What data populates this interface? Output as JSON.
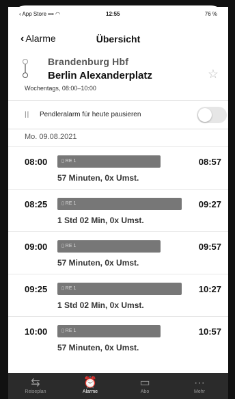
{
  "status_bar": {
    "carrier": "App Store",
    "time": "12:55",
    "battery": "76 %"
  },
  "nav": {
    "back_label": "Alarme",
    "title": "Übersicht"
  },
  "route": {
    "from": "Brandenburg Hbf",
    "to": "Berlin Alexanderplatz",
    "schedule": "Wochentags, 08:00–10:00"
  },
  "pause": {
    "label": "Pendleralarm für heute pausieren",
    "enabled": false
  },
  "date": "Mo. 09.08.2021",
  "entries": [
    {
      "departure": "08:00",
      "arrival": "08:57",
      "train": "RE 1",
      "info": "57 Minuten,  0x Umst.",
      "bar_fraction": 0.77
    },
    {
      "departure": "08:25",
      "arrival": "09:27",
      "train": "RE 1",
      "info": "1 Std 02 Min,  0x Umst.",
      "bar_fraction": 0.93
    },
    {
      "departure": "09:00",
      "arrival": "09:57",
      "train": "RE 1",
      "info": "57 Minuten,  0x Umst.",
      "bar_fraction": 0.77
    },
    {
      "departure": "09:25",
      "arrival": "10:27",
      "train": "RE 1",
      "info": "1 Std 02 Min,  0x Umst.",
      "bar_fraction": 0.93
    },
    {
      "departure": "10:00",
      "arrival": "10:57",
      "train": "RE 1",
      "info": "57 Minuten,  0x Umst.",
      "bar_fraction": 0.77
    }
  ],
  "tabs": [
    {
      "label": "Reiseplan",
      "icon": "route-icon"
    },
    {
      "label": "Alarme",
      "icon": "alarm-icon",
      "active": true
    },
    {
      "label": "Abo",
      "icon": "ticket-icon"
    },
    {
      "label": "Mehr",
      "icon": "more-icon"
    }
  ]
}
